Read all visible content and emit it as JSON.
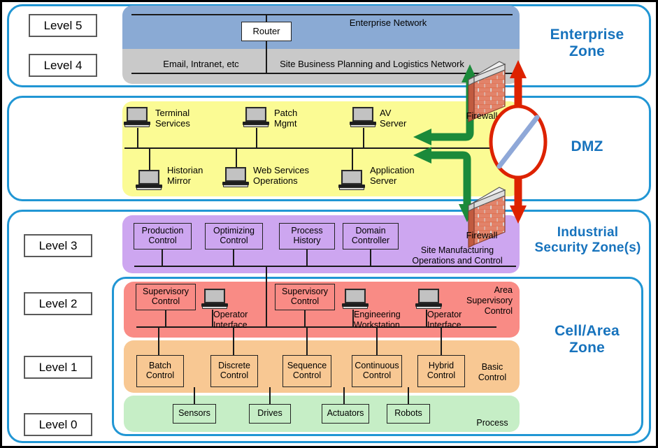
{
  "diagram": {
    "title": "Purdue Model Industrial Network Segmentation",
    "colors": {
      "zone_border": "#2196d4",
      "zone_caption": "#1773bd",
      "level5_band": "#8aaad4",
      "level4_band": "#c9c9c9",
      "dmz_band": "#fbfb94",
      "level3_band": "#cda6f0",
      "level2_band": "#f98b85",
      "level1_band": "#f8c893",
      "level0_band": "#c6eec6",
      "allow_arrow": "#1b8a3a",
      "deny_arrow": "#dd2200",
      "brick": "#d4estimate"
    }
  },
  "zones": [
    {
      "id": "enterprise",
      "caption": "Enterprise\nZone"
    },
    {
      "id": "dmz",
      "caption": "DMZ"
    },
    {
      "id": "industrial",
      "caption": "Industrial\nSecurity Zone(s)"
    },
    {
      "id": "cellarea",
      "caption": "Cell/Area\nZone"
    }
  ],
  "levels": [
    {
      "id": "level5",
      "label": "Level 5"
    },
    {
      "id": "level4",
      "label": "Level 4"
    },
    {
      "id": "level3",
      "label": "Level 3"
    },
    {
      "id": "level2",
      "label": "Level 2"
    },
    {
      "id": "level1",
      "label": "Level 1"
    },
    {
      "id": "level0",
      "label": "Level 0"
    }
  ],
  "enterprise": {
    "level5": {
      "network_label": "Enterprise Network",
      "router_label": "Router"
    },
    "level4": {
      "left_label": "Email, Intranet, etc",
      "network_label": "Site Business Planning and Logistics Network"
    }
  },
  "dmz": {
    "top_row": [
      {
        "label": "Terminal\nServices",
        "icon": "laptop-icon"
      },
      {
        "label": "Patch\nMgmt",
        "icon": "laptop-icon"
      },
      {
        "label": "AV\nServer",
        "icon": "laptop-icon"
      }
    ],
    "bottom_row": [
      {
        "label": "Historian\nMirror",
        "icon": "laptop-icon"
      },
      {
        "label": "Web Services\nOperations",
        "icon": "laptop-icon"
      },
      {
        "label": "Application\nServer",
        "icon": "laptop-icon"
      }
    ]
  },
  "industrial": {
    "level3": {
      "nodes": [
        {
          "label": "Production\nControl"
        },
        {
          "label": "Optimizing\nControl"
        },
        {
          "label": "Process\nHistory"
        },
        {
          "label": "Domain\nController"
        }
      ],
      "network_label": "Site Manufacturing\nOperations and Control"
    }
  },
  "cellarea": {
    "level2": {
      "group_label": "Area\nSupervisory\nControl",
      "items": [
        {
          "label": "Supervisory\nControl",
          "type": "box"
        },
        {
          "label": "Operator\nInterface",
          "type": "laptop"
        },
        {
          "label": "Supervisory\nControl",
          "type": "box"
        },
        {
          "label": "Engineering\nWorkstation",
          "type": "laptop"
        },
        {
          "label": "Operator\nInterface",
          "type": "laptop"
        }
      ]
    },
    "level1": {
      "group_label": "Basic\nControl",
      "nodes": [
        {
          "label": "Batch\nControl"
        },
        {
          "label": "Discrete\nControl"
        },
        {
          "label": "Sequence\nControl"
        },
        {
          "label": "Continuous\nControl"
        },
        {
          "label": "Hybrid\nControl"
        }
      ]
    },
    "level0": {
      "group_label": "Process",
      "nodes": [
        {
          "label": "Sensors"
        },
        {
          "label": "Drives"
        },
        {
          "label": "Actuators"
        },
        {
          "label": "Robots"
        }
      ]
    }
  },
  "firewalls": [
    {
      "id": "firewall-enterprise-dmz",
      "label": "Firewall"
    },
    {
      "id": "firewall-dmz-industrial",
      "label": "Firewall"
    }
  ],
  "traffic": {
    "allowed_arrows": [
      {
        "from": "dmz",
        "to": "enterprise",
        "color": "#1b8a3a"
      },
      {
        "from": "dmz-upper-bus",
        "to": "dmz",
        "color": "#1b8a3a"
      },
      {
        "from": "dmz-lower-bus",
        "to": "dmz",
        "color": "#1b8a3a"
      },
      {
        "from": "dmz",
        "to": "industrial",
        "color": "#1b8a3a"
      }
    ],
    "blocked_arrow": {
      "description": "No direct traffic between Enterprise and Industrial zones",
      "color": "#dd2200",
      "symbol": "no-entry-circle"
    }
  }
}
